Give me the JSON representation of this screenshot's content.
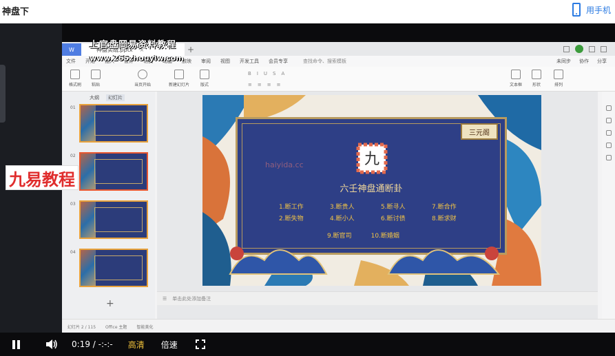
{
  "header": {
    "title": "神盘下",
    "phone_link": "用手机"
  },
  "overlay": {
    "course_title": "上官盘岡易资料教程",
    "site_url": "www.265zhouyiw.com",
    "brand_tag": "九易教程"
  },
  "wps": {
    "doc_tab": "神盘实战.pptx",
    "menus": [
      "文件",
      "开始",
      "插入",
      "设计",
      "切换",
      "动画",
      "放映",
      "审阅",
      "视图",
      "开发工具",
      "会员专享"
    ],
    "search_placeholder": "查找命令、搜索模板",
    "menu_right": [
      "未同步",
      "协作",
      "分享"
    ],
    "ribbon_buttons": [
      "格式刷",
      "粘贴",
      "当页开始",
      "新建幻灯片",
      "版式",
      "文本框",
      "形状",
      "排列"
    ],
    "panel_tabs": [
      "大纲",
      "幻灯片"
    ],
    "slide_numbers": [
      "01",
      "02",
      "03",
      "04"
    ],
    "notes_placeholder": "单击此处添加备注",
    "status_items": [
      "幻灯片 2 / 115",
      "Office 主题",
      "智能美化"
    ]
  },
  "slide": {
    "badge": "三元阁",
    "seal_char": "九",
    "watermark": "haiyida.cc",
    "title": "六壬神盘通断卦",
    "items": [
      "1.断工作",
      "3.断贵人",
      "5.断寻人",
      "7.断合作",
      "2.断失物",
      "4.断小人",
      "6.断讨债",
      "8.断求财"
    ],
    "bottom_items": [
      "9.断官司",
      "10.断婚姻"
    ]
  },
  "controls": {
    "time": "0:19 / -:-:-",
    "quality": "高清",
    "speed": "倍速"
  },
  "colors": {
    "panel": "#2e3f86",
    "gold": "#f1c347",
    "accent": "#e02d2d"
  }
}
